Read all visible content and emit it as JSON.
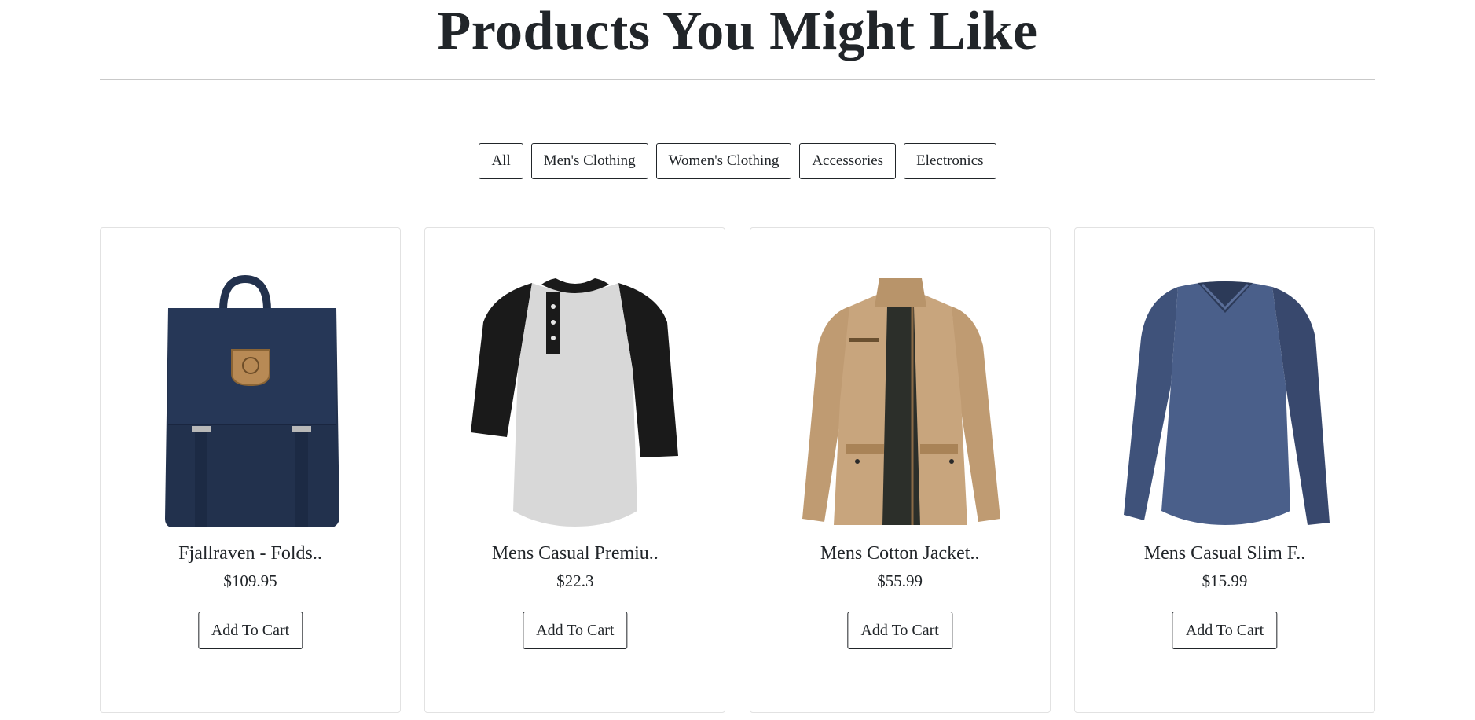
{
  "page": {
    "title": "Products You Might Like"
  },
  "filters": [
    {
      "label": "All"
    },
    {
      "label": "Men's Clothing"
    },
    {
      "label": "Women's Clothing"
    },
    {
      "label": "Accessories"
    },
    {
      "label": "Electronics"
    }
  ],
  "products": [
    {
      "title": "Fjallraven - Folds..",
      "price": "$109.95",
      "button": "Add To Cart",
      "image_icon": "backpack-image"
    },
    {
      "title": "Mens Casual Premiu..",
      "price": "$22.3",
      "button": "Add To Cart",
      "image_icon": "raglan-shirt-image"
    },
    {
      "title": "Mens Cotton Jacket..",
      "price": "$55.99",
      "button": "Add To Cart",
      "image_icon": "jacket-image"
    },
    {
      "title": "Mens Casual Slim F..",
      "price": "$15.99",
      "button": "Add To Cart",
      "image_icon": "longsleeve-shirt-image"
    }
  ],
  "colors": {
    "text": "#212529",
    "border": "#e2e2e2",
    "backpack": "#22314d",
    "shirt_body": "#d9d9d9",
    "shirt_sleeve": "#1a1a1a",
    "jacket": "#c8a57d",
    "longsleeve": "#4a5f8a"
  }
}
